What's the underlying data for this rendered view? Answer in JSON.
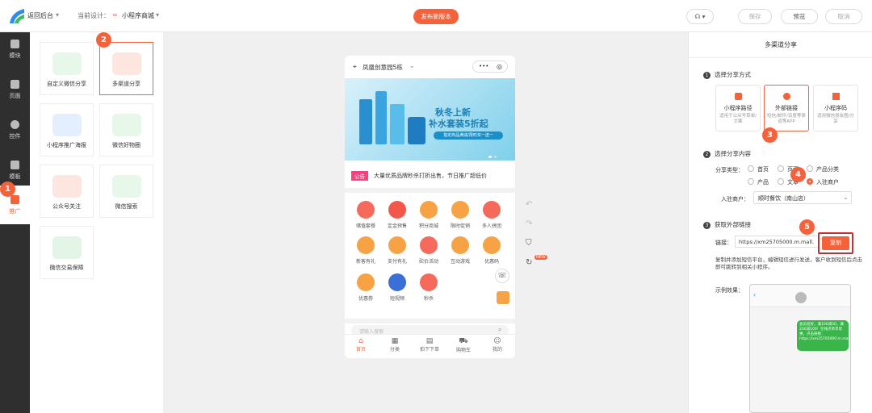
{
  "topbar": {
    "back_label": "返回后台",
    "design_label": "当前设计：",
    "design_value": "小程序商城",
    "publish_label": "发布新版本",
    "save_label": "保存",
    "preview_label": "预览",
    "cancel_label": "取消"
  },
  "leftnav": {
    "items": [
      {
        "label": "模块"
      },
      {
        "label": "页面"
      },
      {
        "label": "控件"
      },
      {
        "label": "模板"
      },
      {
        "label": "推广"
      }
    ]
  },
  "panel": {
    "cards": [
      {
        "label": "自定义微信分享"
      },
      {
        "label": "多渠道分享"
      },
      {
        "label": "小程序推广海报"
      },
      {
        "label": "微信好物圈"
      },
      {
        "label": "公众号关注"
      },
      {
        "label": "微信搜索"
      },
      {
        "label": "微信交易保障"
      }
    ]
  },
  "phone": {
    "location": "凤凰创意园5栋",
    "more": "•••",
    "banner_title": "秋冬上新",
    "banner_subtitle": "补水套装5折起",
    "banner_small": "指定商品满减/限时买一送一",
    "notice_tag": "公告",
    "notice_text": "大量优质品牌秒杀打折出售，节日推广超低价",
    "grid": [
      {
        "label": "储值套餐",
        "color": "#f56a5a"
      },
      {
        "label": "定金预售",
        "color": "#f2574a"
      },
      {
        "label": "积分商城",
        "color": "#f7a244"
      },
      {
        "label": "限时促销",
        "color": "#f7a244"
      },
      {
        "label": "多人拼团",
        "color": "#f56a5a"
      },
      {
        "label": "新客有礼",
        "color": "#f7a244"
      },
      {
        "label": "支付有礼",
        "color": "#f7a244"
      },
      {
        "label": "砍价活动",
        "color": "#f56a5a"
      },
      {
        "label": "互动游戏",
        "color": "#f7a244"
      },
      {
        "label": "优惠码",
        "color": "#f7a244"
      },
      {
        "label": "优惠券",
        "color": "#f7a244"
      },
      {
        "label": "短视频",
        "color": "#3a6fd8"
      },
      {
        "label": "秒杀",
        "color": "#f56a5a"
      }
    ],
    "search_placeholder": "请输入搜索",
    "tabs": [
      {
        "label": "首页"
      },
      {
        "label": "分类"
      },
      {
        "label": "拍下下单"
      },
      {
        "label": "购物车"
      },
      {
        "label": "我的"
      }
    ]
  },
  "canvas_tools": {
    "new_tag": "NEW"
  },
  "rpanel": {
    "title": "多渠道分享",
    "section1_title": "选择分享方式",
    "options": [
      {
        "title": "小程序路径",
        "desc": "适用于公众号菜单/文案"
      },
      {
        "title": "外部链接",
        "desc": "短信/邮件/百度等渠道等APP"
      },
      {
        "title": "小程序码",
        "desc": "适用微信朋友圈/分享"
      }
    ],
    "section2_title": "选择分享内容",
    "share_type_label": "分享类型：",
    "radios": [
      "首页",
      "页面",
      "产品分类",
      "产品",
      "文章",
      "入驻商户"
    ],
    "entry_label": "入驻商户：",
    "entry_value": "顺时餐饮（南山店）",
    "section3_title": "获取外部链接",
    "link_label": "链接：",
    "link_value": "https://xm25705000.m.mall.",
    "copy_label": "复制",
    "tip_text": "复制并添加短信平台，编辑短信进行发送，客户收到短信后点击即可跳转到相关小程序。",
    "example_label": "示例效果：",
    "sms_text": "会员您好，满100减50，满200减100！在线点单享优惠，点击链接：https://xm25705000.m.mall..."
  },
  "badges": [
    "1",
    "2",
    "3",
    "4",
    "5"
  ]
}
